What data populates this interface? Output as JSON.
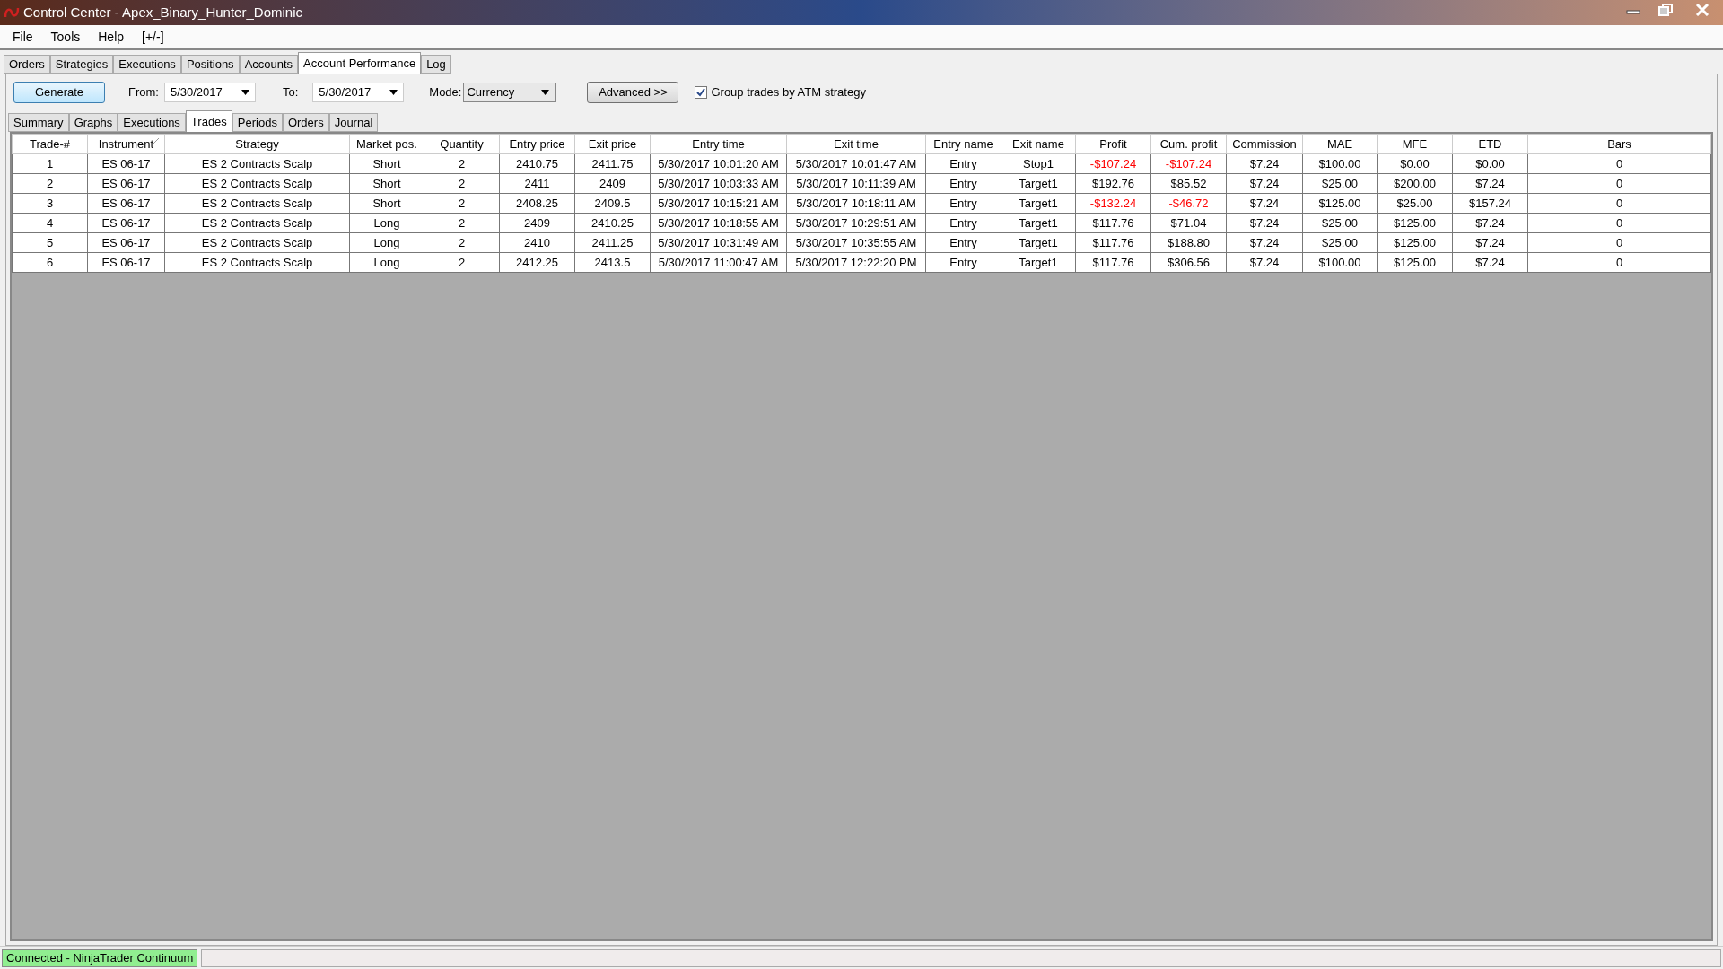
{
  "window": {
    "title": "Control Center - Apex_Binary_Hunter_Dominic"
  },
  "menu": [
    "File",
    "Tools",
    "Help",
    "[+/-]"
  ],
  "tabs": [
    {
      "label": "Orders",
      "selected": false
    },
    {
      "label": "Strategies",
      "selected": false
    },
    {
      "label": "Executions",
      "selected": false
    },
    {
      "label": "Positions",
      "selected": false
    },
    {
      "label": "Accounts",
      "selected": false
    },
    {
      "label": "Account Performance",
      "selected": true
    },
    {
      "label": "Log",
      "selected": false
    }
  ],
  "toolbar": {
    "generate": "Generate",
    "from_label": "From:",
    "from_value": "5/30/2017",
    "to_label": "To:",
    "to_value": "5/30/2017",
    "mode_label": "Mode:",
    "mode_value": "Currency",
    "advanced": "Advanced >>",
    "group_trades": {
      "label": "Group trades by ATM strategy",
      "checked": true
    }
  },
  "subtabs": [
    {
      "label": "Summary",
      "selected": false
    },
    {
      "label": "Graphs",
      "selected": false
    },
    {
      "label": "Executions",
      "selected": false
    },
    {
      "label": "Trades",
      "selected": true
    },
    {
      "label": "Periods",
      "selected": false
    },
    {
      "label": "Orders",
      "selected": false
    },
    {
      "label": "Journal",
      "selected": false
    }
  ],
  "table": {
    "columns": [
      {
        "label": "Trade-#",
        "sorted": false
      },
      {
        "label": "Instrument",
        "sorted": true
      },
      {
        "label": "Strategy",
        "sorted": false
      },
      {
        "label": "Market pos.",
        "sorted": false
      },
      {
        "label": "Quantity",
        "sorted": false
      },
      {
        "label": "Entry price",
        "sorted": false
      },
      {
        "label": "Exit price",
        "sorted": false
      },
      {
        "label": "Entry time",
        "sorted": false
      },
      {
        "label": "Exit time",
        "sorted": false
      },
      {
        "label": "Entry name",
        "sorted": false
      },
      {
        "label": "Exit name",
        "sorted": false
      },
      {
        "label": "Profit",
        "sorted": false
      },
      {
        "label": "Cum. profit",
        "sorted": false
      },
      {
        "label": "Commission",
        "sorted": false
      },
      {
        "label": "MAE",
        "sorted": false
      },
      {
        "label": "MFE",
        "sorted": false
      },
      {
        "label": "ETD",
        "sorted": false
      },
      {
        "label": "Bars",
        "sorted": false
      }
    ],
    "rows": [
      {
        "cells": [
          "1",
          "ES 06-17",
          "ES 2 Contracts Scalp",
          "Short",
          "2",
          "2410.75",
          "2411.75",
          "5/30/2017 10:01:20 AM",
          "5/30/2017 10:01:47 AM",
          "Entry",
          "Stop1",
          "-$107.24",
          "-$107.24",
          "$7.24",
          "$100.00",
          "$0.00",
          "$0.00",
          "0"
        ],
        "profit_negative": true,
        "cum_profit_negative": true
      },
      {
        "cells": [
          "2",
          "ES 06-17",
          "ES 2 Contracts Scalp",
          "Short",
          "2",
          "2411",
          "2409",
          "5/30/2017 10:03:33 AM",
          "5/30/2017 10:11:39 AM",
          "Entry",
          "Target1",
          "$192.76",
          "$85.52",
          "$7.24",
          "$25.00",
          "$200.00",
          "$7.24",
          "0"
        ],
        "profit_negative": false,
        "cum_profit_negative": false
      },
      {
        "cells": [
          "3",
          "ES 06-17",
          "ES 2 Contracts Scalp",
          "Short",
          "2",
          "2408.25",
          "2409.5",
          "5/30/2017 10:15:21 AM",
          "5/30/2017 10:18:11 AM",
          "Entry",
          "Target1",
          "-$132.24",
          "-$46.72",
          "$7.24",
          "$125.00",
          "$25.00",
          "$157.24",
          "0"
        ],
        "profit_negative": true,
        "cum_profit_negative": true
      },
      {
        "cells": [
          "4",
          "ES 06-17",
          "ES 2 Contracts Scalp",
          "Long",
          "2",
          "2409",
          "2410.25",
          "5/30/2017 10:18:55 AM",
          "5/30/2017 10:29:51 AM",
          "Entry",
          "Target1",
          "$117.76",
          "$71.04",
          "$7.24",
          "$25.00",
          "$125.00",
          "$7.24",
          "0"
        ],
        "profit_negative": false,
        "cum_profit_negative": false
      },
      {
        "cells": [
          "5",
          "ES 06-17",
          "ES 2 Contracts Scalp",
          "Long",
          "2",
          "2410",
          "2411.25",
          "5/30/2017 10:31:49 AM",
          "5/30/2017 10:35:55 AM",
          "Entry",
          "Target1",
          "$117.76",
          "$188.80",
          "$7.24",
          "$25.00",
          "$125.00",
          "$7.24",
          "0"
        ],
        "profit_negative": false,
        "cum_profit_negative": false
      },
      {
        "cells": [
          "6",
          "ES 06-17",
          "ES 2 Contracts Scalp",
          "Long",
          "2",
          "2412.25",
          "2413.5",
          "5/30/2017 11:00:47 AM",
          "5/30/2017 12:22:20 PM",
          "Entry",
          "Target1",
          "$117.76",
          "$306.56",
          "$7.24",
          "$100.00",
          "$125.00",
          "$7.24",
          "0"
        ],
        "profit_negative": false,
        "cum_profit_negative": false
      }
    ]
  },
  "status_bar": {
    "connection": "Connected - NinjaTrader Continuum"
  }
}
